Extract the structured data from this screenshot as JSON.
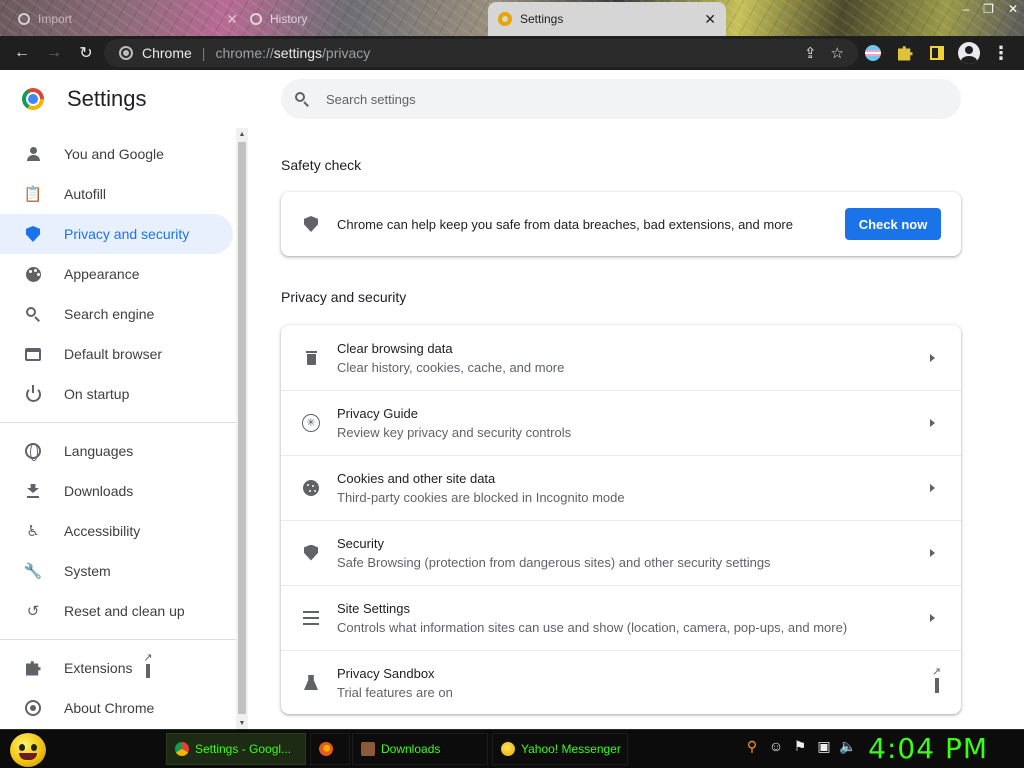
{
  "browser": {
    "tabs": [
      {
        "title": "Import",
        "active": false
      },
      {
        "title": "History",
        "active": false
      },
      {
        "title": "Settings",
        "active": true
      }
    ],
    "close_glyph": "✕",
    "window_controls": [
      "–",
      "❐",
      "✕"
    ],
    "omnibox": {
      "site_label": "Chrome",
      "separator": "|",
      "url_prefix": "chrome://",
      "url_host": "settings",
      "url_path": "/privacy"
    },
    "nav": {
      "back": "←",
      "forward": "→",
      "reload": "↻"
    },
    "actions": {
      "share": "⇪",
      "bookmark": "☆"
    }
  },
  "settings": {
    "title": "Settings",
    "search_placeholder": "Search settings",
    "sidebar": {
      "items": [
        {
          "label": "You and Google",
          "icon": "person-icon",
          "active": false
        },
        {
          "label": "Autofill",
          "icon": "clipboard-icon",
          "active": false
        },
        {
          "label": "Privacy and security",
          "icon": "shield-icon",
          "active": true
        },
        {
          "label": "Appearance",
          "icon": "palette-icon",
          "active": false
        },
        {
          "label": "Search engine",
          "icon": "search-icon",
          "active": false
        },
        {
          "label": "Default browser",
          "icon": "browser-icon",
          "active": false
        },
        {
          "label": "On startup",
          "icon": "power-icon",
          "active": false
        },
        {
          "label": "Languages",
          "icon": "globe-icon",
          "active": false
        },
        {
          "label": "Downloads",
          "icon": "download-icon",
          "active": false
        },
        {
          "label": "Accessibility",
          "icon": "accessibility-icon",
          "active": false
        },
        {
          "label": "System",
          "icon": "wrench-icon",
          "active": false
        },
        {
          "label": "Reset and clean up",
          "icon": "history-icon",
          "active": false
        },
        {
          "label": "Extensions",
          "icon": "puzzle-icon",
          "active": false
        },
        {
          "label": "About Chrome",
          "icon": "chrome-icon",
          "active": false
        }
      ]
    },
    "safety_check": {
      "heading": "Safety check",
      "text": "Chrome can help keep you safe from data breaches, bad extensions, and more",
      "button": "Check now"
    },
    "privacy": {
      "heading": "Privacy and security",
      "rows": [
        {
          "title": "Clear browsing data",
          "subtitle": "Clear history, cookies, cache, and more",
          "icon": "trash-icon"
        },
        {
          "title": "Privacy Guide",
          "subtitle": "Review key privacy and security controls",
          "icon": "compass-icon"
        },
        {
          "title": "Cookies and other site data",
          "subtitle": "Third-party cookies are blocked in Incognito mode",
          "icon": "cookie-icon"
        },
        {
          "title": "Security",
          "subtitle": "Safe Browsing (protection from dangerous sites) and other security settings",
          "icon": "shield-icon"
        },
        {
          "title": "Site Settings",
          "subtitle": "Controls what information sites can use and show (location, camera, pop-ups, and more)",
          "icon": "tune-icon"
        },
        {
          "title": "Privacy Sandbox",
          "subtitle": "Trial features are on",
          "icon": "flask-icon"
        }
      ]
    }
  },
  "taskbar": {
    "items": [
      {
        "label": "Settings - Googl...",
        "active": true
      },
      {
        "label": "",
        "active": false
      },
      {
        "label": "Downloads",
        "active": false
      },
      {
        "label": "Yahoo! Messenger",
        "active": false
      }
    ],
    "clock": "4:04 PM"
  },
  "colors": {
    "accent": "#1a73e8",
    "active_nav_bg": "#e8f0fe",
    "taskbar_text": "#39ff14"
  }
}
